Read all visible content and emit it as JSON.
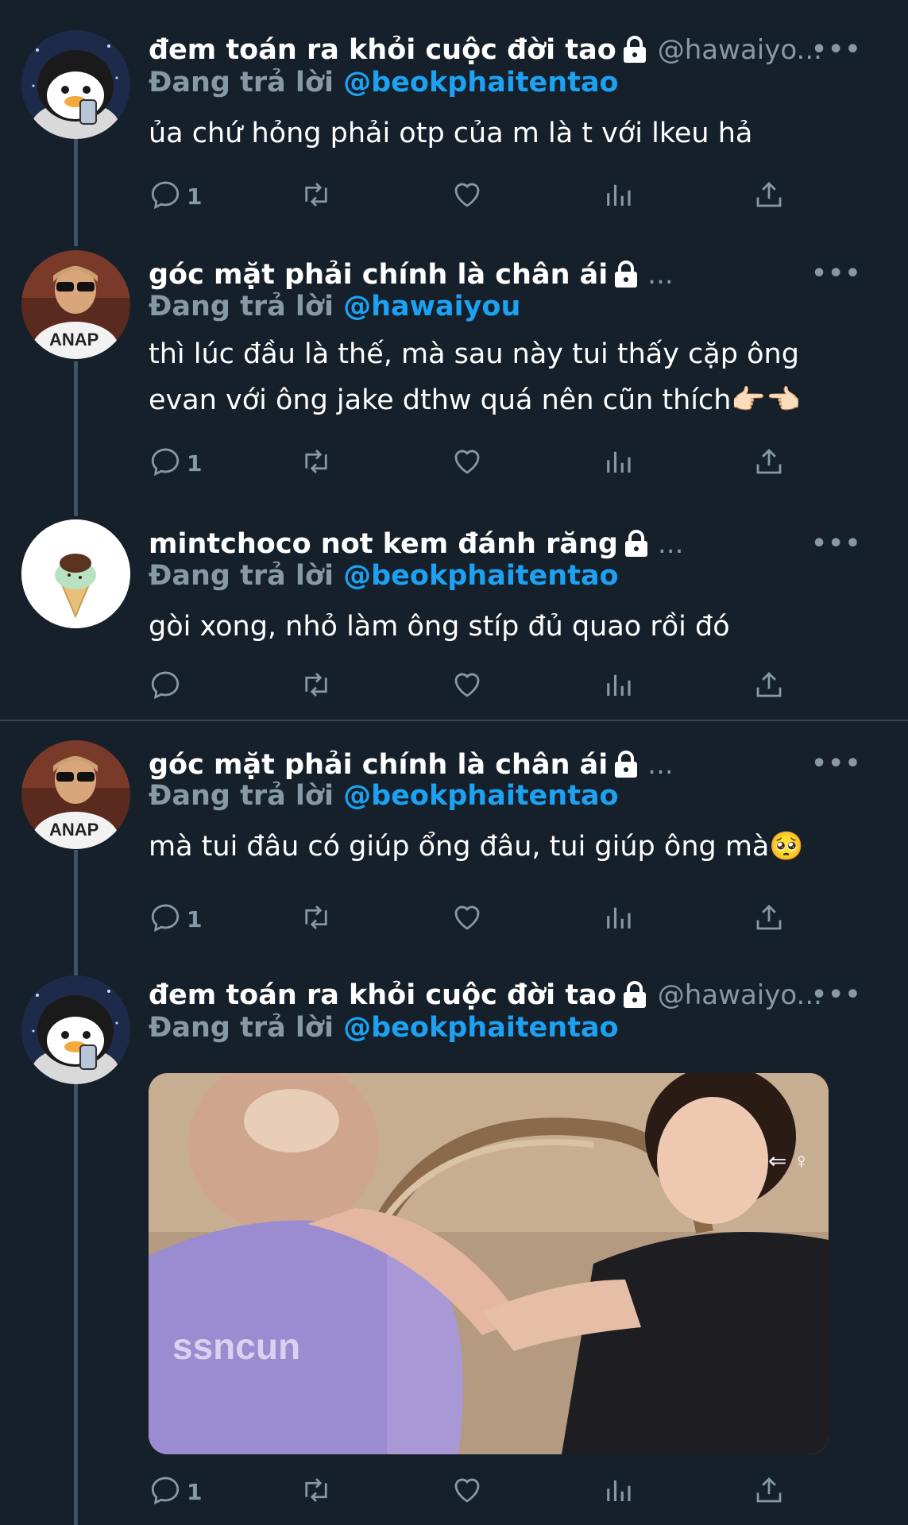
{
  "tweets": [
    {
      "name": "đem toán ra khỏi cuộc đời tao",
      "handle": "@hawaiyo...",
      "reply_label": "Đang trả lời",
      "reply_to": "@beokphaitentao",
      "text": "ủa chứ hỏng phải otp của m là t với lkeu hả",
      "reply_count": "1"
    },
    {
      "name": "góc mặt phải chính là chân ái",
      "handle": "...",
      "reply_label": "Đang trả lời",
      "reply_to": "@hawaiyou",
      "text": "thì lúc đầu là thế, mà sau này tui thấy cặp ông evan với ông jake dthw quá nên cũn thích👉🏻👈🏻",
      "reply_count": "1"
    },
    {
      "name": "mintchoco not kem đánh răng",
      "handle": "...",
      "reply_label": "Đang trả lời",
      "reply_to": "@beokphaitentao",
      "text": "gòi xong, nhỏ làm ông stíp đủ quao rồi đó",
      "reply_count": ""
    },
    {
      "name": "góc mặt phải chính là chân ái",
      "handle": "...",
      "reply_label": "Đang trả lời",
      "reply_to": "@beokphaitentao",
      "text": "mà tui đâu có giúp ổng đâu, tui giúp ông mà🥺",
      "reply_count": "1"
    },
    {
      "name": "đem toán ra khỏi cuộc đời tao",
      "handle": "@hawaiyo...",
      "reply_label": "Đang trả lời",
      "reply_to": "@beokphaitentao",
      "text": "",
      "reply_count": "1",
      "media_overlay_text": "ssncun"
    }
  ],
  "more_label": "•••",
  "colors": {
    "background": "#15202b",
    "secondary_text": "#8899a6",
    "link": "#1da1f2",
    "divider": "#38444d"
  },
  "icons": [
    "reply-icon",
    "retweet-icon",
    "like-icon",
    "analytics-icon",
    "share-icon",
    "lock-icon",
    "more-icon"
  ]
}
